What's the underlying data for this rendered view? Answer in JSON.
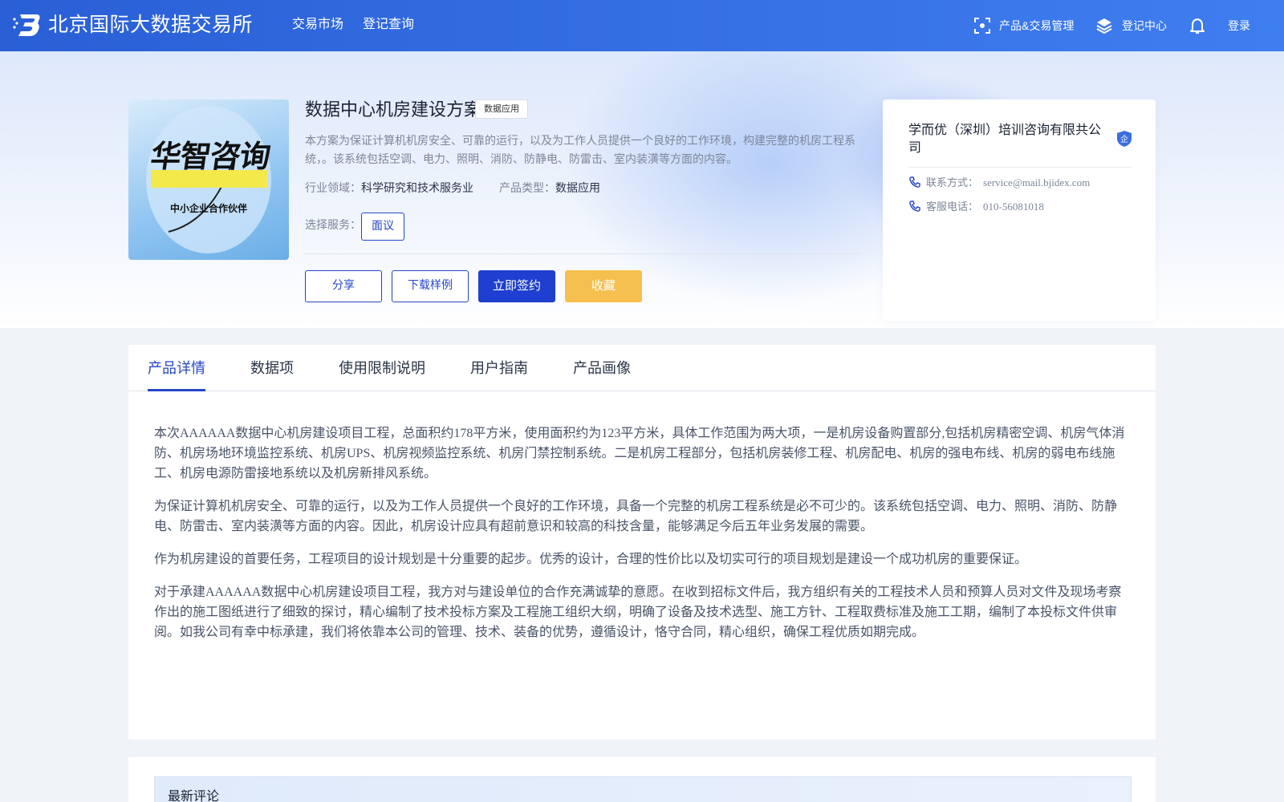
{
  "header": {
    "site_name": "北京国际大数据交易所",
    "nav": [
      "交易市场",
      "登记查询"
    ],
    "product_trade_mgmt": "产品&交易管理",
    "registration_center": "登记中心",
    "login": "登录"
  },
  "product": {
    "image_text_main": "华智咨询",
    "image_text_sub": "中小企业合作伙伴",
    "title": "数据中心机房建设方案",
    "tag": "数据应用",
    "description": "本方案为保证计算机机房安全、可靠的运行，以及为工作人员提供一个良好的工作环境，构建完整的机房工程系统，。该系统包括空调、电力、照明、消防、防静电、防雷击、室内装潢等方面的内容。",
    "industry_label": "行业领域：",
    "industry_value": "科学研究和技术服务业",
    "type_label": "产品类型：",
    "type_value": "数据应用",
    "service_label": "选择服务：",
    "service_option": "面议",
    "buttons": {
      "share": "分享",
      "download": "下载样例",
      "sign": "立即签约",
      "favorite": "收藏"
    }
  },
  "company": {
    "name": "学而优（深圳）培训咨询有限共公司",
    "badge": "企",
    "contact_label": "联系方式：",
    "contact_value": "service@mail.bjidex.com",
    "phone_label": "客服电话：",
    "phone_value": "010-56081018"
  },
  "tabs": [
    "产品详情",
    "数据项",
    "使用限制说明",
    "用户指南",
    "产品画像"
  ],
  "active_tab": "产品详情",
  "content": [
    "本次AAAAAA数据中心机房建设项目工程，总面积约178平方米，使用面积约为123平方米，具体工作范围为两大项，一是机房设备购置部分,包括机房精密空调、机房气体消防、机房场地环境监控系统、机房UPS、机房视频监控系统、机房门禁控制系统。二是机房工程部分，包括机房装修工程、机房配电、机房的强电布线、机房的弱电布线施工、机房电源防雷接地系统以及机房新排风系统。",
    "为保证计算机机房安全、可靠的运行，以及为工作人员提供一个良好的工作环境，具备一个完整的机房工程系统是必不可少的。该系统包括空调、电力、照明、消防、防静电、防雷击、室内装潢等方面的内容。因此，机房设计应具有超前意识和较高的科技含量，能够满足今后五年业务发展的需要。",
    "作为机房建设的首要任务，工程项目的设计规划是十分重要的起步。优秀的设计，合理的性价比以及切实可行的项目规划是建设一个成功机房的重要保证。",
    "对于承建AAAAAA数据中心机房建设项目工程，我方对与建设单位的合作充满诚挚的意愿。在收到招标文件后，我方组织有关的工程技术人员和预算人员对文件及现场考察作出的施工图纸进行了细致的探讨，精心编制了技术投标方案及工程施工组织大纲，明确了设备及技术选型、施工方针、工程取费标准及施工工期，编制了本投标文件供审阅。如我公司有幸中标承建，我们将依靠本公司的管理、技术、装备的优势，遵循设计，恪守合同，精心组织，确保工程优质如期完成。"
  ],
  "comments": {
    "title": "最新评论"
  },
  "colors": {
    "header_gradient_start": "#2a5fd6",
    "header_gradient_end": "#3f7ef0",
    "primary": "#1e3fd0",
    "accent_yellow": "#f5c04f"
  }
}
